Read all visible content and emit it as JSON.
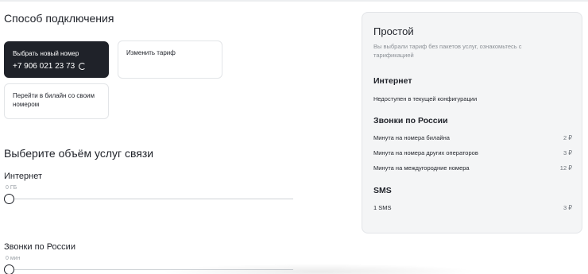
{
  "connection": {
    "title": "Способ подключения",
    "new_number": {
      "label": "Выбрать новый номер",
      "phone": "+7 906 021 23 73"
    },
    "change_tariff": {
      "label": "Изменить тариф"
    },
    "own_number": {
      "label": "Перейти в билайн со своим номером"
    }
  },
  "volume": {
    "title": "Выберите объём услуг связи",
    "internet": {
      "label": "Интернет",
      "value": "0 ГБ",
      "level": 0
    },
    "calls": {
      "label": "Звонки по России",
      "value": "0 мин",
      "level": 0
    }
  },
  "summary": {
    "title": "Простой",
    "description": "Вы выбрали тариф без пакетов услуг, ознакомьтесь с тарификацией",
    "internet_heading": "Интернет",
    "internet_status": "Недоступен в текущей конфигурации",
    "calls_heading": "Звонки по России",
    "calls": [
      {
        "name": "Минута на номера билайна",
        "price": "2 ₽"
      },
      {
        "name": "Минута на номера других операторов",
        "price": "3 ₽"
      },
      {
        "name": "Минута на междугородние номера",
        "price": "12 ₽"
      }
    ],
    "sms_heading": "SMS",
    "sms": {
      "name": "1 SMS",
      "price": "3 ₽"
    }
  },
  "colors": {
    "dark": "#1f2229",
    "panel": "#f4f5f6",
    "muted": "#8b9096"
  },
  "icons": {
    "loading": "refresh-spinner-icon"
  }
}
